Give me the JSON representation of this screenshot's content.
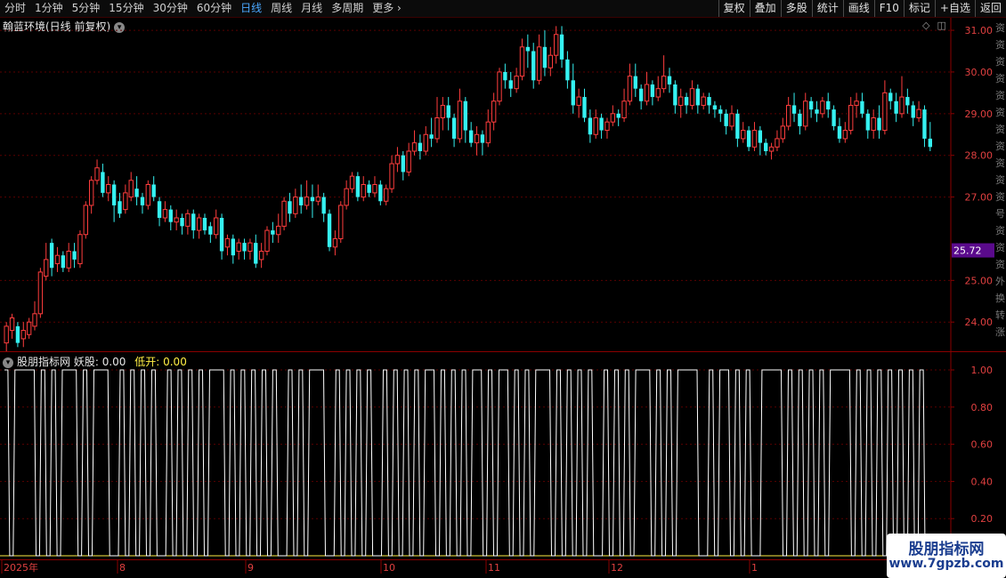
{
  "toolbar": {
    "periods": [
      "分时",
      "1分钟",
      "5分钟",
      "15分钟",
      "30分钟",
      "60分钟",
      "日线",
      "周线",
      "月线",
      "多周期"
    ],
    "active_period": "日线",
    "more_label": "更多",
    "more_icon": "chevron-right-icon",
    "right_buttons": [
      "复权",
      "叠加",
      "多股",
      "统计",
      "画线",
      "F10",
      "标记",
      "+自选",
      "返回"
    ]
  },
  "chart_title": "翰蓝环境(日线 前复权)",
  "top_icons": [
    "◇",
    "◫"
  ],
  "indicator": {
    "name": "股朋指标网",
    "line1_label": "妖股: 0.00",
    "line2_label": "低开: 0.00"
  },
  "colors": {
    "up": "#ff3d3d",
    "down": "#35f1f1",
    "price_tag_bg": "#5a0a8c",
    "grid": "#5a0000",
    "axis_text": "#e04040",
    "indicator_line": "#ffffff",
    "baseline": "#ffee44"
  },
  "right_edge_text": [
    "资",
    "资",
    "资",
    "资",
    "资",
    "资",
    "资",
    "资",
    "资",
    "资",
    "资",
    "号",
    "资",
    "资",
    "资",
    "外",
    "换",
    "转",
    "涨"
  ],
  "watermark": {
    "title": "股朋指标网",
    "url": "www.7gpzb.com"
  },
  "chart_data": [
    {
      "type": "candlestick",
      "y_ticks": [
        "31.00",
        "30.00",
        "29.00",
        "28.00",
        "27.00",
        "25.00",
        "24.00"
      ],
      "price_tag": "25.72",
      "ylim": [
        23.3,
        31.3
      ],
      "x_labels": [
        "2025年",
        "8",
        "9",
        "10",
        "11",
        "12",
        "1"
      ],
      "candles": [
        [
          23.5,
          23.9,
          23.3,
          24.0
        ],
        [
          23.8,
          24.1,
          23.6,
          24.2
        ],
        [
          23.9,
          23.5,
          23.4,
          24.0
        ],
        [
          23.6,
          23.8,
          23.4,
          24.0
        ],
        [
          23.7,
          24.0,
          23.6,
          24.1
        ],
        [
          23.9,
          24.2,
          23.8,
          24.5
        ],
        [
          24.2,
          25.2,
          24.1,
          25.3
        ],
        [
          25.1,
          25.5,
          25.0,
          25.9
        ],
        [
          25.9,
          25.3,
          25.1,
          26.0
        ],
        [
          25.4,
          25.6,
          25.2,
          25.8
        ],
        [
          25.6,
          25.3,
          25.2,
          25.7
        ],
        [
          25.3,
          25.7,
          25.2,
          25.9
        ],
        [
          25.7,
          25.5,
          25.3,
          25.9
        ],
        [
          25.4,
          26.1,
          25.3,
          26.2
        ],
        [
          26.1,
          26.8,
          26.0,
          26.9
        ],
        [
          26.8,
          27.4,
          26.6,
          27.5
        ],
        [
          27.4,
          27.7,
          27.3,
          27.9
        ],
        [
          27.6,
          27.1,
          27.0,
          27.8
        ],
        [
          27.1,
          27.3,
          26.9,
          27.5
        ],
        [
          27.3,
          26.8,
          26.4,
          27.4
        ],
        [
          26.9,
          26.6,
          26.5,
          27.1
        ],
        [
          26.7,
          27.1,
          26.6,
          27.3
        ],
        [
          27.0,
          27.4,
          26.9,
          27.6
        ],
        [
          27.2,
          27.0,
          26.8,
          27.5
        ],
        [
          27.0,
          26.8,
          26.6,
          27.1
        ],
        [
          26.8,
          27.3,
          26.7,
          27.4
        ],
        [
          27.3,
          27.0,
          26.9,
          27.5
        ],
        [
          26.9,
          26.5,
          26.3,
          27.0
        ],
        [
          26.5,
          26.7,
          26.4,
          26.9
        ],
        [
          26.7,
          26.4,
          26.2,
          26.8
        ],
        [
          26.4,
          26.5,
          26.2,
          26.7
        ],
        [
          26.5,
          26.3,
          26.1,
          26.6
        ],
        [
          26.3,
          26.6,
          26.1,
          26.7
        ],
        [
          26.6,
          26.2,
          26.0,
          26.7
        ],
        [
          26.2,
          26.5,
          26.0,
          26.6
        ],
        [
          26.5,
          26.2,
          26.1,
          26.6
        ],
        [
          26.3,
          26.1,
          25.9,
          26.4
        ],
        [
          26.1,
          26.5,
          26.0,
          26.7
        ],
        [
          26.5,
          25.7,
          25.5,
          26.6
        ],
        [
          25.8,
          26.0,
          25.6,
          26.1
        ],
        [
          26.0,
          25.6,
          25.4,
          26.1
        ],
        [
          25.7,
          25.9,
          25.5,
          26.0
        ],
        [
          25.9,
          25.7,
          25.5,
          26.0
        ],
        [
          25.7,
          25.9,
          25.5,
          26.0
        ],
        [
          25.9,
          25.4,
          25.3,
          26.1
        ],
        [
          25.5,
          25.7,
          25.3,
          25.9
        ],
        [
          25.7,
          26.2,
          25.6,
          26.3
        ],
        [
          26.2,
          26.1,
          25.9,
          26.4
        ],
        [
          26.1,
          26.3,
          25.9,
          26.6
        ],
        [
          26.3,
          26.9,
          26.2,
          27.0
        ],
        [
          26.9,
          26.6,
          26.4,
          27.1
        ],
        [
          26.6,
          27.0,
          26.5,
          27.2
        ],
        [
          27.0,
          26.8,
          26.6,
          27.3
        ],
        [
          26.8,
          27.0,
          26.7,
          27.4
        ],
        [
          27.0,
          26.9,
          26.5,
          27.3
        ],
        [
          26.9,
          27.0,
          26.8,
          27.3
        ],
        [
          27.0,
          26.6,
          26.4,
          27.1
        ],
        [
          26.6,
          25.8,
          25.7,
          26.7
        ],
        [
          25.8,
          26.0,
          25.6,
          26.2
        ],
        [
          26.0,
          26.8,
          25.9,
          26.9
        ],
        [
          26.8,
          27.2,
          26.7,
          27.4
        ],
        [
          27.2,
          27.5,
          27.1,
          27.6
        ],
        [
          27.5,
          27.0,
          26.9,
          27.6
        ],
        [
          27.0,
          27.3,
          26.9,
          27.5
        ],
        [
          27.3,
          27.1,
          27.0,
          27.4
        ],
        [
          27.1,
          27.3,
          27.0,
          27.5
        ],
        [
          27.3,
          26.9,
          26.8,
          27.4
        ],
        [
          26.9,
          27.2,
          26.8,
          27.3
        ],
        [
          27.2,
          27.8,
          27.1,
          28.0
        ],
        [
          27.8,
          28.0,
          27.6,
          28.2
        ],
        [
          28.0,
          27.6,
          27.4,
          28.1
        ],
        [
          27.6,
          28.1,
          27.5,
          28.3
        ],
        [
          28.1,
          28.3,
          28.0,
          28.6
        ],
        [
          28.3,
          28.1,
          27.9,
          28.5
        ],
        [
          28.1,
          28.5,
          28.0,
          28.7
        ],
        [
          28.5,
          28.4,
          28.2,
          28.9
        ],
        [
          28.4,
          28.9,
          28.3,
          29.4
        ],
        [
          28.9,
          29.2,
          28.6,
          29.4
        ],
        [
          29.2,
          28.9,
          28.6,
          29.4
        ],
        [
          28.9,
          28.4,
          28.2,
          29.0
        ],
        [
          28.4,
          29.3,
          28.3,
          29.6
        ],
        [
          29.3,
          28.6,
          28.3,
          29.4
        ],
        [
          28.6,
          28.3,
          28.2,
          28.8
        ],
        [
          28.3,
          28.5,
          28.0,
          28.7
        ],
        [
          28.5,
          28.3,
          28.0,
          28.6
        ],
        [
          28.3,
          28.8,
          28.2,
          29.1
        ],
        [
          28.8,
          29.3,
          28.6,
          29.5
        ],
        [
          29.3,
          30.0,
          29.2,
          30.1
        ],
        [
          30.0,
          29.8,
          29.6,
          30.2
        ],
        [
          29.8,
          29.6,
          29.4,
          30.0
        ],
        [
          29.6,
          29.9,
          29.5,
          30.1
        ],
        [
          29.9,
          30.6,
          29.8,
          30.8
        ],
        [
          30.6,
          30.5,
          30.1,
          30.9
        ],
        [
          30.5,
          29.8,
          29.6,
          30.7
        ],
        [
          29.8,
          30.6,
          29.7,
          30.9
        ],
        [
          30.6,
          30.1,
          29.9,
          31.0
        ],
        [
          30.1,
          30.4,
          29.9,
          30.6
        ],
        [
          30.4,
          30.9,
          30.2,
          31.1
        ],
        [
          30.9,
          30.3,
          30.1,
          31.1
        ],
        [
          30.3,
          29.8,
          29.6,
          30.5
        ],
        [
          29.8,
          29.2,
          29.0,
          30.2
        ],
        [
          29.2,
          29.4,
          28.9,
          29.6
        ],
        [
          29.4,
          28.9,
          28.8,
          29.6
        ],
        [
          28.9,
          28.5,
          28.3,
          29.1
        ],
        [
          28.5,
          28.9,
          28.4,
          29.1
        ],
        [
          28.9,
          28.6,
          28.4,
          29.0
        ],
        [
          28.6,
          28.8,
          28.4,
          28.9
        ],
        [
          28.8,
          29.0,
          28.7,
          29.2
        ],
        [
          29.0,
          28.9,
          28.7,
          29.1
        ],
        [
          28.9,
          29.3,
          28.8,
          29.6
        ],
        [
          29.3,
          29.9,
          29.2,
          30.2
        ],
        [
          29.9,
          29.6,
          29.4,
          30.2
        ],
        [
          29.6,
          29.3,
          29.1,
          29.7
        ],
        [
          29.3,
          29.7,
          29.2,
          30.0
        ],
        [
          29.7,
          29.4,
          29.2,
          29.8
        ],
        [
          29.4,
          29.6,
          29.3,
          29.9
        ],
        [
          29.6,
          29.9,
          29.5,
          30.4
        ],
        [
          29.9,
          29.7,
          29.5,
          30.1
        ],
        [
          29.7,
          29.2,
          29.0,
          29.8
        ],
        [
          29.2,
          29.4,
          28.9,
          29.6
        ],
        [
          29.4,
          29.2,
          29.0,
          29.5
        ],
        [
          29.2,
          29.6,
          29.1,
          29.8
        ],
        [
          29.6,
          29.2,
          29.0,
          29.7
        ],
        [
          29.2,
          29.4,
          29.1,
          29.5
        ],
        [
          29.4,
          29.2,
          29.0,
          29.5
        ],
        [
          29.2,
          29.1,
          28.9,
          29.3
        ],
        [
          29.1,
          29.0,
          28.8,
          29.2
        ],
        [
          29.0,
          28.7,
          28.5,
          29.1
        ],
        [
          28.7,
          29.0,
          28.6,
          29.2
        ],
        [
          29.0,
          28.4,
          28.2,
          29.1
        ],
        [
          28.4,
          28.6,
          28.3,
          28.8
        ],
        [
          28.6,
          28.2,
          28.1,
          28.7
        ],
        [
          28.2,
          28.6,
          28.1,
          28.8
        ],
        [
          28.6,
          28.3,
          28.0,
          28.7
        ],
        [
          28.3,
          28.1,
          28.0,
          28.4
        ],
        [
          28.1,
          28.2,
          27.9,
          28.3
        ],
        [
          28.2,
          28.4,
          28.1,
          28.6
        ],
        [
          28.4,
          28.7,
          28.3,
          28.9
        ],
        [
          28.7,
          29.2,
          28.6,
          29.4
        ],
        [
          29.2,
          29.0,
          28.8,
          29.5
        ],
        [
          29.0,
          28.7,
          28.5,
          29.1
        ],
        [
          28.7,
          29.3,
          28.6,
          29.5
        ],
        [
          29.3,
          29.1,
          28.9,
          29.4
        ],
        [
          29.1,
          29.0,
          28.8,
          29.3
        ],
        [
          29.0,
          29.3,
          28.9,
          29.4
        ],
        [
          29.3,
          29.1,
          28.9,
          29.5
        ],
        [
          29.1,
          28.7,
          28.6,
          29.2
        ],
        [
          28.7,
          28.4,
          28.3,
          28.9
        ],
        [
          28.4,
          28.6,
          28.3,
          28.8
        ],
        [
          28.6,
          29.2,
          28.5,
          29.4
        ],
        [
          29.2,
          29.3,
          28.9,
          29.5
        ],
        [
          29.3,
          29.0,
          28.9,
          29.5
        ],
        [
          29.0,
          28.6,
          28.4,
          29.1
        ],
        [
          28.6,
          28.9,
          28.4,
          29.1
        ],
        [
          28.9,
          28.6,
          28.4,
          29.2
        ],
        [
          28.6,
          29.5,
          28.5,
          29.8
        ],
        [
          29.5,
          29.3,
          29.1,
          29.6
        ],
        [
          29.3,
          29.0,
          28.8,
          29.5
        ],
        [
          29.0,
          29.4,
          28.9,
          29.9
        ],
        [
          29.4,
          29.2,
          29.0,
          29.6
        ],
        [
          29.2,
          28.9,
          28.7,
          29.3
        ],
        [
          28.9,
          29.1,
          28.8,
          29.3
        ],
        [
          29.1,
          28.4,
          28.2,
          29.2
        ],
        [
          28.4,
          28.2,
          28.1,
          28.8
        ]
      ]
    },
    {
      "type": "line",
      "y_ticks": [
        "1.00",
        "0.80",
        "0.60",
        "0.40",
        "0.20"
      ],
      "ylim": [
        0,
        1.0
      ],
      "series": [
        {
          "values": [
            1,
            0,
            1,
            1,
            1,
            1,
            0,
            1,
            0,
            1,
            0,
            1,
            1,
            1,
            0,
            1,
            0,
            1,
            1,
            1,
            0,
            0,
            1,
            0,
            1,
            0,
            1,
            0,
            1,
            0,
            0,
            1,
            0,
            1,
            0,
            1,
            0,
            1,
            0,
            1,
            1,
            1,
            0,
            1,
            0,
            1,
            0,
            1,
            0,
            1,
            0,
            1,
            0,
            0,
            1,
            0,
            1,
            0,
            1,
            1,
            1,
            0,
            0,
            1,
            0,
            1,
            0,
            1,
            0,
            1,
            0,
            0,
            1,
            0,
            1,
            0,
            1,
            0,
            1,
            0,
            1,
            1,
            0,
            1,
            0,
            1,
            0,
            1,
            0,
            1,
            1,
            0,
            1,
            0,
            1,
            1,
            0,
            1,
            0,
            1,
            0,
            1,
            1,
            1,
            0,
            1,
            0,
            1,
            0,
            1,
            0,
            1,
            0,
            0,
            1,
            0,
            1,
            0,
            1,
            0,
            1,
            1,
            1,
            0,
            1,
            0,
            1,
            0,
            1,
            1,
            1,
            1,
            0,
            0,
            1,
            0,
            1,
            1,
            0,
            1,
            0,
            1,
            0,
            0,
            1,
            1,
            1,
            1,
            0,
            1,
            0,
            1,
            0,
            1,
            0,
            1,
            0,
            1,
            1,
            1,
            1,
            0,
            1,
            0,
            1,
            0,
            1,
            0,
            1,
            0,
            1,
            0,
            1,
            0,
            1,
            0
          ]
        }
      ]
    }
  ]
}
